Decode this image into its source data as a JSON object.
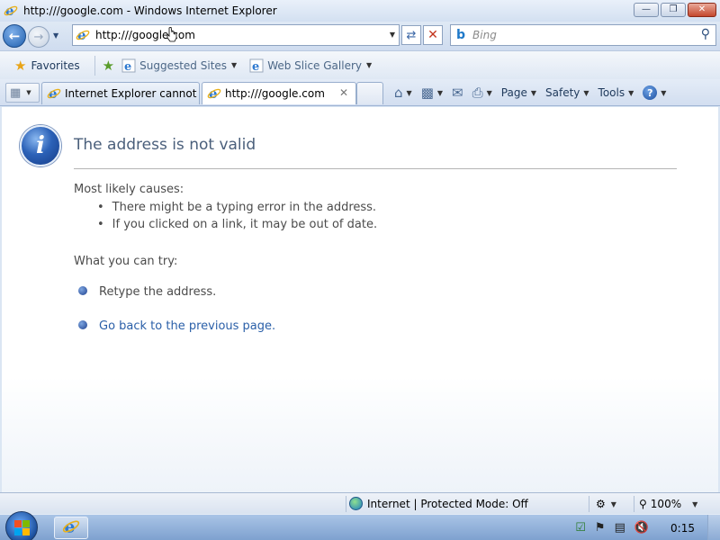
{
  "window": {
    "title": "http:///google.com - Windows Internet Explorer",
    "minimize_glyph": "▭",
    "maximize_glyph": "❐",
    "close_glyph": "✕"
  },
  "address_bar": {
    "url": "http:///google.com"
  },
  "search": {
    "placeholder": "Bing"
  },
  "favorites_bar": {
    "favorites_label": "Favorites",
    "items": [
      {
        "label": "Suggested Sites"
      },
      {
        "label": "Web Slice Gallery"
      }
    ]
  },
  "tabs": [
    {
      "label": "Internet Explorer cannot d..."
    },
    {
      "label": "http:///google.com",
      "close": "✕"
    }
  ],
  "command_bar": {
    "page": "Page",
    "safety": "Safety",
    "tools": "Tools",
    "help": "?"
  },
  "error_page": {
    "title": "The address is not valid",
    "causes_heading": "Most likely causes:",
    "causes": [
      "There might be a typing error in the address.",
      "If you clicked on a link, it may be out of date."
    ],
    "try_heading": "What you can try:",
    "try_items": [
      {
        "text": "Retype the address."
      },
      {
        "text": "Go back to the previous page."
      }
    ]
  },
  "status_bar": {
    "zone": "Internet | Protected Mode: Off",
    "zoom": "100%"
  },
  "taskbar": {
    "clock": "0:15"
  },
  "colors": {
    "accent": "#1f5fae",
    "link": "#2a5fa8",
    "title_text": "#4a5f7b"
  },
  "icons": {
    "info": "info-icon",
    "ie": "internet-explorer-icon",
    "globe": "globe-icon"
  }
}
